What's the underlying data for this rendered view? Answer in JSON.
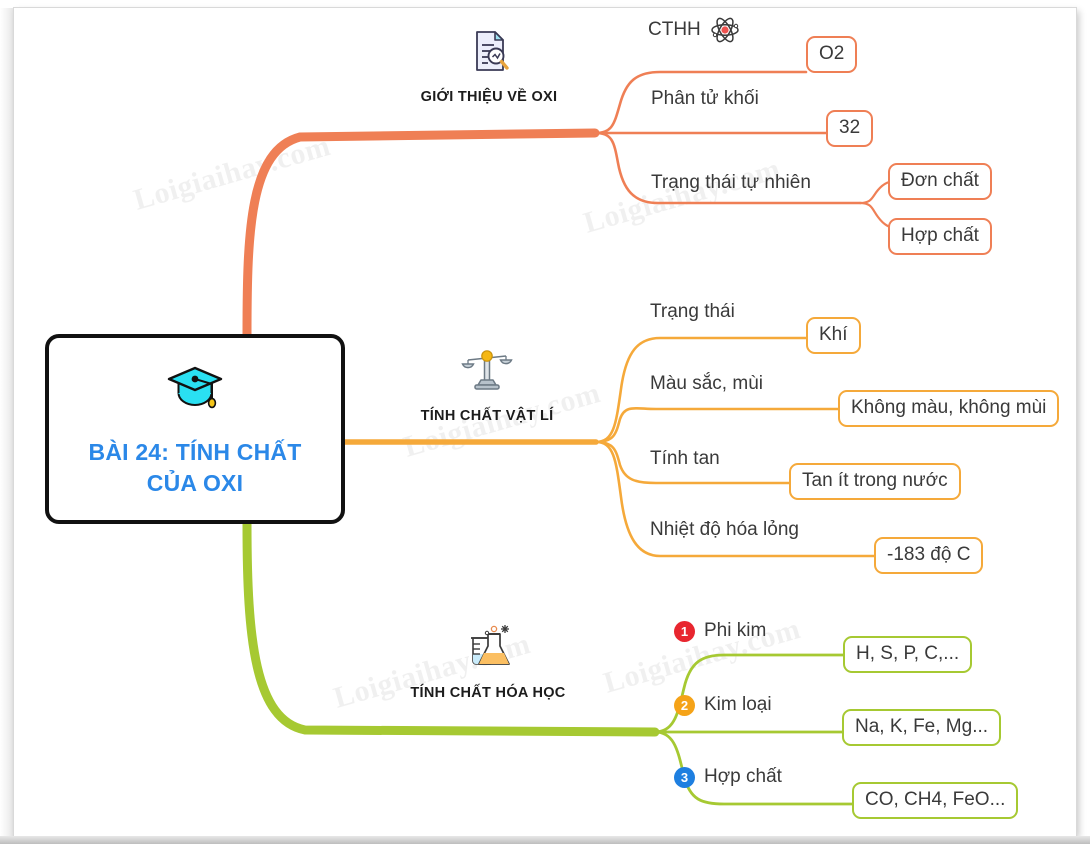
{
  "central": {
    "icon": "graduation-cap-icon",
    "title": "BÀI 24: TÍNH CHẤT\nCỦA OXI",
    "title_color": "#2b88e8"
  },
  "watermark": {
    "text": "Loigiaihay.com"
  },
  "branches": [
    {
      "id": "gioi-thieu",
      "label": "GIỚI THIỆU VỀ OXI",
      "icon": "document-search-icon",
      "color": "#ef7f55",
      "children": [
        {
          "label": "CTHH",
          "icon": "atom-icon",
          "leaf": "O2"
        },
        {
          "label": "Phân tử khối",
          "leaf": "32"
        },
        {
          "label": "Trạng thái tự nhiên",
          "leaves": [
            "Đơn chất",
            "Hợp chất"
          ]
        }
      ]
    },
    {
      "id": "vat-li",
      "label": "TÍNH CHẤT VẬT LÍ",
      "icon": "balance-scale-icon",
      "color": "#f5a93a",
      "children": [
        {
          "label": "Trạng thái",
          "leaf": "Khí"
        },
        {
          "label": "Màu sắc, mùi",
          "leaf": "Không màu, không mùi"
        },
        {
          "label": "Tính tan",
          "leaf": "Tan ít trong nước"
        },
        {
          "label": "Nhiệt độ hóa lỏng",
          "leaf": "-183 độ C"
        }
      ]
    },
    {
      "id": "hoa-hoc",
      "label": "TÍNH CHẤT HÓA HỌC",
      "icon": "flask-beaker-icon",
      "color": "#a6c932",
      "children": [
        {
          "number": "1",
          "number_color": "#e8262f",
          "label": "Phi kim",
          "leaf": "H, S, P, C,..."
        },
        {
          "number": "2",
          "number_color": "#f5a318",
          "label": "Kim loại",
          "leaf": "Na, K, Fe, Mg..."
        },
        {
          "number": "3",
          "number_color": "#1e7fe0",
          "label": "Hợp chất",
          "leaf": "CO, CH4, FeO..."
        }
      ]
    }
  ]
}
